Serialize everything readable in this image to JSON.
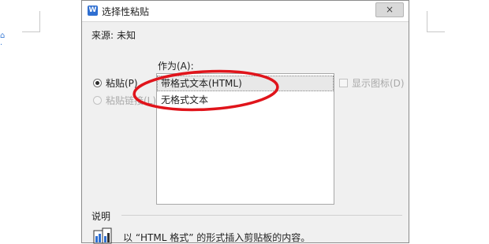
{
  "dialog": {
    "title": "选择性粘贴",
    "app_icon_letter": "W",
    "close_symbol": "×",
    "source_label": "来源:",
    "source_value": "未知",
    "as_label": "作为(A):",
    "options": {
      "paste_label": "粘贴(P)",
      "paste_link_label": "粘贴链接(L)"
    },
    "list_items": [
      "带格式文本(HTML)",
      "无格式文本"
    ],
    "show_icon_label": "显示图标(D)",
    "description_label": "说明",
    "description_text": "以 “HTML 格式” 的形式插入剪贴板的内容。"
  },
  "annotation": {
    "color": "#e0141b"
  },
  "colors": {
    "accent": "#2f6fd1"
  }
}
